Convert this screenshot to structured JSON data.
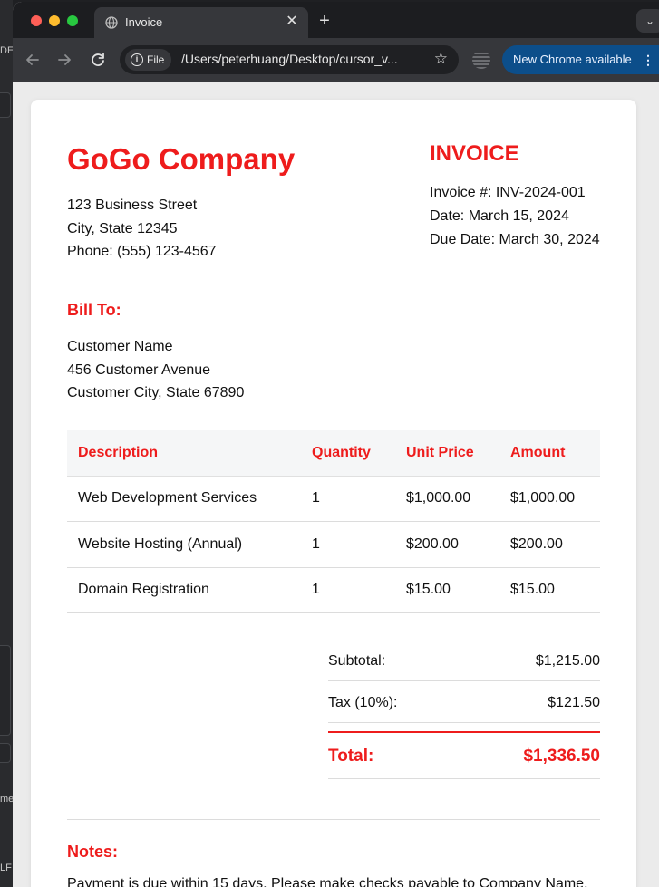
{
  "background_window": {
    "fragment_top": "DE",
    "fragment_mid": "me",
    "fragment_bottom": "LF"
  },
  "browser": {
    "tab_title": "Invoice",
    "tab_close": "✕",
    "new_tab": "+",
    "tab_menu": "⌄",
    "file_chip": "File",
    "url": "/Users/peterhuang/Desktop/cursor_v...",
    "update_button": "New Chrome available",
    "update_menu": "⋮"
  },
  "colors": {
    "accent": "#ee1c1c",
    "page": "#ffffff",
    "header_row": "#f5f6f7"
  },
  "company": {
    "name": "GoGo Company",
    "street": "123 Business Street",
    "city": "City, State 12345",
    "phone": "Phone: (555) 123-4567"
  },
  "invoice": {
    "title": "INVOICE",
    "number": "Invoice #: INV-2024-001",
    "date": "Date: March 15, 2024",
    "due_date": "Due Date: March 30, 2024"
  },
  "bill_to": {
    "heading": "Bill To:",
    "name": "Customer Name",
    "street": "456 Customer Avenue",
    "city": "Customer City, State 67890"
  },
  "items_table": {
    "headers": [
      "Description",
      "Quantity",
      "Unit Price",
      "Amount"
    ],
    "rows": [
      [
        "Web Development Services",
        "1",
        "$1,000.00",
        "$1,000.00"
      ],
      [
        "Website Hosting (Annual)",
        "1",
        "$200.00",
        "$200.00"
      ],
      [
        "Domain Registration",
        "1",
        "$15.00",
        "$15.00"
      ]
    ]
  },
  "totals": {
    "subtotal_label": "Subtotal:",
    "subtotal_value": "$1,215.00",
    "tax_label": "Tax (10%):",
    "tax_value": "$121.50",
    "total_label": "Total:",
    "total_value": "$1,336.50"
  },
  "notes": {
    "heading": "Notes:",
    "text": "Payment is due within 15 days. Please make checks payable to Company Name."
  }
}
